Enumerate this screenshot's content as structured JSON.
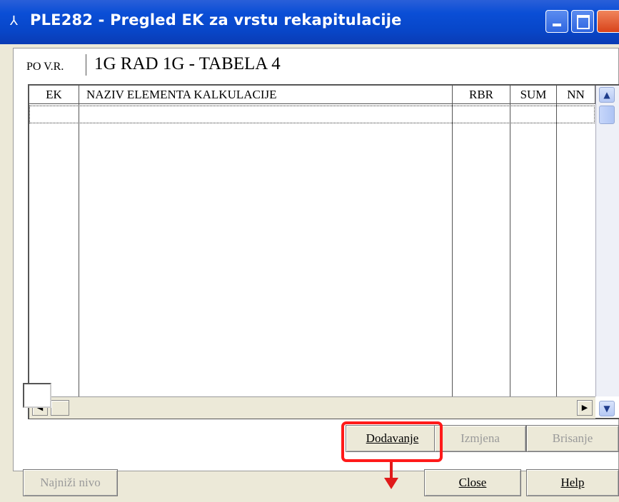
{
  "window": {
    "title": "PLE282 - Pregled EK za vrstu rekapitulacije",
    "icon": "app-icon"
  },
  "tab": {
    "label": "PO V.R.",
    "title": "1G RAD 1G - TABELA 4"
  },
  "grid": {
    "columns": [
      "EK",
      "NAZIV ELEMENTA KALKULACIJE",
      "RBR",
      "SUM",
      "NN"
    ],
    "rows": []
  },
  "buttons": {
    "dodavanje": "Dodavanje",
    "izmjena": "Izmjena",
    "brisanje": "Brisanje",
    "najnizi": "Najniži nivo",
    "close": "Close",
    "help": "Help"
  },
  "colors": {
    "highlight": "#ff1a1a",
    "titlebar": "#0a4ed6"
  }
}
